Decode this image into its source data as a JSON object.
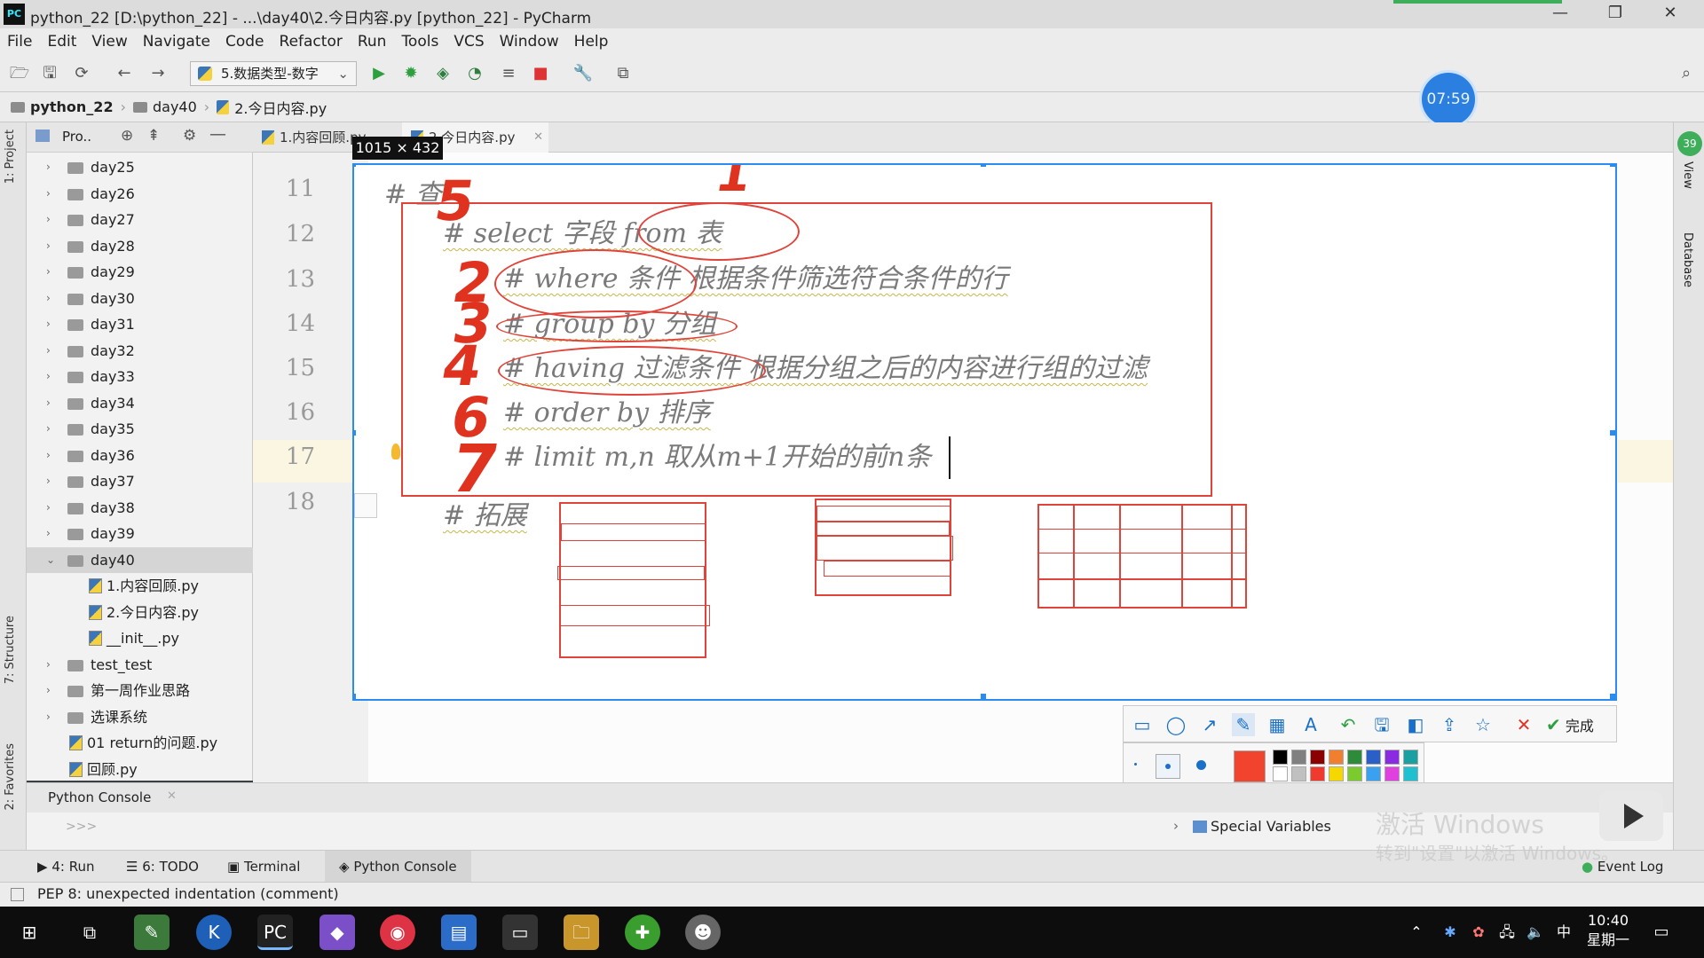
{
  "window": {
    "title": "python_22 [D:\\python_22] - ...\\day40\\2.今日内容.py [python_22] - PyCharm",
    "app_icon": "PC",
    "controls": [
      "—",
      "❐",
      "✕"
    ]
  },
  "menu": [
    "File",
    "Edit",
    "View",
    "Navigate",
    "Code",
    "Refactor",
    "Run",
    "Tools",
    "VCS",
    "Window",
    "Help"
  ],
  "toolbar": {
    "run_config": "5.数据类型-数字"
  },
  "breadcrumb": [
    "python_22",
    "day40",
    "2.今日内容.py"
  ],
  "timer_badge": "07:59",
  "left_stripe": {
    "project": "1: Project",
    "structure": "7: Structure",
    "favorites": "2: Favorites"
  },
  "right_stripe": {
    "view": "View",
    "database": "Database",
    "badge": "39"
  },
  "project_panel": {
    "header": "Pro..",
    "tree": [
      {
        "label": "day25",
        "type": "folder",
        "expanded": false,
        "indent": 0
      },
      {
        "label": "day26",
        "type": "folder",
        "expanded": false,
        "indent": 0
      },
      {
        "label": "day27",
        "type": "folder",
        "expanded": false,
        "indent": 0
      },
      {
        "label": "day28",
        "type": "folder",
        "expanded": false,
        "indent": 0
      },
      {
        "label": "day29",
        "type": "folder",
        "expanded": false,
        "indent": 0
      },
      {
        "label": "day30",
        "type": "folder",
        "expanded": false,
        "indent": 0
      },
      {
        "label": "day31",
        "type": "folder",
        "expanded": false,
        "indent": 0
      },
      {
        "label": "day32",
        "type": "folder",
        "expanded": false,
        "indent": 0
      },
      {
        "label": "day33",
        "type": "folder",
        "expanded": false,
        "indent": 0
      },
      {
        "label": "day34",
        "type": "folder",
        "expanded": false,
        "indent": 0
      },
      {
        "label": "day35",
        "type": "folder",
        "expanded": false,
        "indent": 0
      },
      {
        "label": "day36",
        "type": "folder",
        "expanded": false,
        "indent": 0
      },
      {
        "label": "day37",
        "type": "folder",
        "expanded": false,
        "indent": 0
      },
      {
        "label": "day38",
        "type": "folder",
        "expanded": false,
        "indent": 0
      },
      {
        "label": "day39",
        "type": "folder",
        "expanded": false,
        "indent": 0
      },
      {
        "label": "day40",
        "type": "folder",
        "expanded": true,
        "indent": 0,
        "selected": true
      },
      {
        "label": "1.内容回顾.py",
        "type": "file",
        "indent": 1
      },
      {
        "label": "2.今日内容.py",
        "type": "file",
        "indent": 1
      },
      {
        "label": "__init__.py",
        "type": "file",
        "indent": 1
      },
      {
        "label": "test_test",
        "type": "folder",
        "expanded": false,
        "indent": 0
      },
      {
        "label": "第一周作业思路",
        "type": "folder",
        "expanded": false,
        "indent": 0
      },
      {
        "label": "选课系统",
        "type": "folder",
        "expanded": false,
        "indent": 0
      },
      {
        "label": "01 return的问题.py",
        "type": "file",
        "indent": 0
      },
      {
        "label": "回顾.py",
        "type": "file",
        "indent": 0
      }
    ]
  },
  "editor": {
    "tabs": [
      {
        "label": "1.内容回顾.py",
        "active": false
      },
      {
        "label": "2.今日内容.py",
        "active": true
      }
    ],
    "line_numbers": [
      "11",
      "12",
      "13",
      "14",
      "15",
      "16",
      "17",
      "18"
    ]
  },
  "capture": {
    "size_label": "1015 × 432",
    "code_lines": [
      "# 查",
      "# select 字段 from 表",
      "# where 条件  根据条件筛选符合条件的行",
      "# group by 分组",
      "# having 过滤条件 根据分组之后的内容进行组的过滤",
      "# order by 排序",
      "# limit m,n 取从m+1开始的前n条",
      "# 拓展"
    ],
    "handwritten_numbers": [
      "5",
      "1",
      "2",
      "3",
      "4",
      "6",
      "7"
    ]
  },
  "annotation_toolbar": {
    "tools": [
      "rectangle-icon",
      "ellipse-icon",
      "arrow-icon",
      "pen-icon",
      "mosaic-icon",
      "text-icon",
      "undo-icon",
      "save-icon",
      "pin-icon",
      "share-icon",
      "star-icon",
      "cancel-icon"
    ],
    "done_label": "完成",
    "selected_color": "#f2432f",
    "palette": [
      "#000000",
      "#808080",
      "#8b0000",
      "#f08030",
      "#2e8b3a",
      "#2a5fc8",
      "#8a2be2",
      "#1aa0a0",
      "#ffffff",
      "#c0c0c0",
      "#f03a2e",
      "#f5d800",
      "#7ccb2e",
      "#3aa0f0",
      "#e040e0",
      "#20c0d0"
    ]
  },
  "console": {
    "tab_label": "Python Console",
    "special_variables": "Special Variables",
    "prompt": ">>>"
  },
  "tool_tabs": [
    "4: Run",
    "6: TODO",
    "Terminal",
    "Python Console"
  ],
  "event_log": "Event Log",
  "status": {
    "message": "PEP 8: unexpected indentation (comment)"
  },
  "watermark": {
    "line1": "激活 Windows",
    "line2": "转到\"设置\"以激活 Windows。"
  },
  "taskbar": {
    "time": "10:40",
    "day": "星期一",
    "ime": "中"
  },
  "colors": {
    "accent": "#2a8cf0",
    "annotation_red": "#e0433a"
  }
}
